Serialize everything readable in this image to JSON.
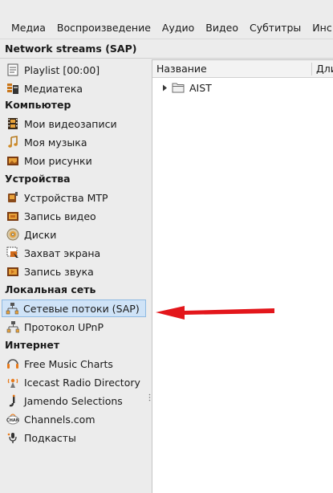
{
  "menubar": {
    "items": [
      "Медиа",
      "Воспроизведение",
      "Аудио",
      "Видео",
      "Субтитры",
      "Инс"
    ]
  },
  "panel_title": "Network streams (SAP)",
  "sidebar": {
    "top_items": [
      {
        "label": "Playlist [00:00]",
        "icon": "playlist-icon"
      },
      {
        "label": "Медиатека",
        "icon": "media-library-icon"
      }
    ],
    "sections": [
      {
        "header": "Компьютер",
        "items": [
          {
            "label": "Мои видеозаписи",
            "icon": "film-icon"
          },
          {
            "label": "Моя музыка",
            "icon": "music-note-icon"
          },
          {
            "label": "Мои рисунки",
            "icon": "picture-icon"
          }
        ]
      },
      {
        "header": "Устройства",
        "items": [
          {
            "label": "Устройства MTP",
            "icon": "mtp-device-icon"
          },
          {
            "label": "Запись видео",
            "icon": "video-capture-icon"
          },
          {
            "label": "Диски",
            "icon": "disc-icon"
          },
          {
            "label": "Захват экрана",
            "icon": "screen-capture-icon"
          },
          {
            "label": "Запись звука",
            "icon": "audio-capture-icon"
          }
        ]
      },
      {
        "header": "Локальная сеть",
        "items": [
          {
            "label": "Сетевые потоки (SAP)",
            "icon": "network-icon",
            "selected": true
          },
          {
            "label": "Протокол UPnP",
            "icon": "network-icon"
          }
        ]
      },
      {
        "header": "Интернет",
        "items": [
          {
            "label": "Free Music Charts",
            "icon": "music-charts-icon"
          },
          {
            "label": "Icecast Radio Directory",
            "icon": "icecast-icon"
          },
          {
            "label": "Jamendo Selections",
            "icon": "jamendo-icon"
          },
          {
            "label": "Channels.com",
            "icon": "channels-icon"
          },
          {
            "label": "Подкасты",
            "icon": "podcast-icon"
          }
        ]
      }
    ]
  },
  "content": {
    "columns": [
      "Название",
      "Дли"
    ],
    "tree": [
      {
        "label": "AIST",
        "icon": "folder-icon",
        "expanded": false
      }
    ]
  },
  "colors": {
    "selection_bg": "#cfe3f7",
    "selection_border": "#8db9e2",
    "arrow": "#e3161b"
  }
}
